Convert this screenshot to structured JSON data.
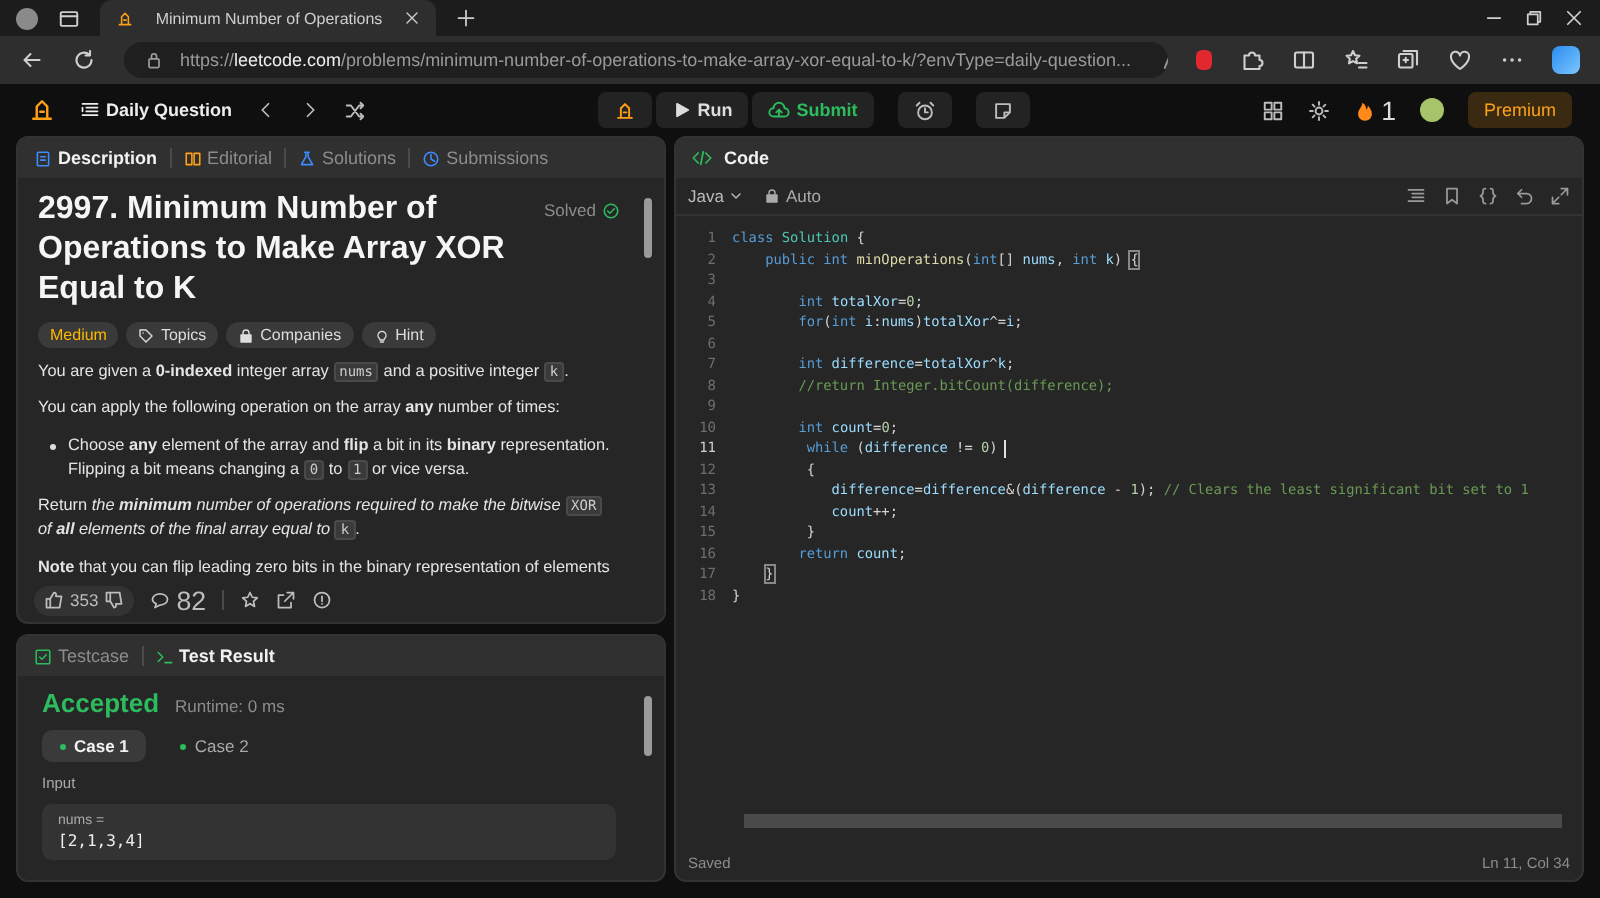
{
  "browser": {
    "tab_title": "Minimum Number of Operations",
    "url": {
      "scheme": "https://",
      "host": "leetcode.com",
      "path": "/problems/minimum-number-of-operations-to-make-array-xor-equal-to-k/?envType=daily-question..."
    }
  },
  "toolbar": {
    "daily_label": "Daily Question",
    "run": "Run",
    "submit": "Submit",
    "streak": "1",
    "premium": "Premium"
  },
  "description_panel": {
    "tabs": [
      {
        "label": "Description",
        "selected": true
      },
      {
        "label": "Editorial",
        "selected": false
      },
      {
        "label": "Solutions",
        "selected": false
      },
      {
        "label": "Submissions",
        "selected": false
      }
    ],
    "title": "2997. Minimum Number of Operations to Make Array XOR Equal to K",
    "status": "Solved",
    "tags": [
      {
        "kind": "difficulty",
        "label": "Medium"
      },
      {
        "kind": "topics",
        "label": "Topics"
      },
      {
        "kind": "companies",
        "label": "Companies"
      },
      {
        "kind": "hint",
        "label": "Hint"
      }
    ],
    "paragraphs": [
      {
        "kind": "para",
        "segments": [
          {
            "kind": "text",
            "text": "You are given a **0-indexed** integer array "
          },
          {
            "kind": "code",
            "text": "nums"
          },
          {
            "kind": "text",
            "text": " and a positive integer "
          },
          {
            "kind": "code",
            "text": "k"
          },
          {
            "kind": "text",
            "text": "."
          }
        ]
      },
      {
        "kind": "para",
        "segments": [
          {
            "kind": "text",
            "text": "You can apply the following operation on the array **any** number of times:"
          }
        ]
      },
      {
        "kind": "bullet",
        "segments": [
          {
            "kind": "text",
            "text": "Choose **any** element of the array and **flip** a bit in its **binary** representation. Flipping a bit means changing a "
          },
          {
            "kind": "code",
            "text": "0"
          },
          {
            "kind": "text",
            "text": " to "
          },
          {
            "kind": "code",
            "text": "1"
          },
          {
            "kind": "text",
            "text": " or vice versa."
          }
        ]
      },
      {
        "kind": "para",
        "segments": [
          {
            "kind": "text",
            "text": "Return "
          },
          {
            "kind": "italic",
            "text": "the **minimum** number of operations required to make the bitwise "
          },
          {
            "kind": "code",
            "text": "XOR"
          },
          {
            "kind": "italic",
            "text": " of **all** elements of the final array equal to "
          },
          {
            "kind": "code",
            "text": "k"
          },
          {
            "kind": "text",
            "text": "."
          }
        ]
      },
      {
        "kind": "para",
        "segments": [
          {
            "kind": "text",
            "text": "**Note** that you can flip leading zero bits in the binary representation of elements"
          }
        ]
      }
    ],
    "likes": "353",
    "comments": "82"
  },
  "test_panel": {
    "tabs": [
      {
        "label": "Testcase",
        "selected": false
      },
      {
        "label": "Test Result",
        "selected": true
      }
    ],
    "verdict": "Accepted",
    "runtime": "Runtime: 0 ms",
    "cases": [
      {
        "label": "Case 1",
        "selected": true,
        "passed": true
      },
      {
        "label": "Case 2",
        "selected": false,
        "passed": true
      }
    ],
    "input_label": "Input",
    "var_name": "nums =",
    "var_value": "[2,1,3,4]"
  },
  "editor": {
    "title": "Code",
    "language": "Java",
    "mode": "Auto",
    "lines": [
      {
        "number": "1",
        "current": false,
        "tokens": [
          {
            "kind": "kw",
            "t": "class "
          },
          {
            "kind": "type",
            "t": "Solution"
          },
          {
            "kind": "plain",
            "t": " {"
          }
        ]
      },
      {
        "number": "2",
        "current": false,
        "tokens": [
          {
            "kind": "kw",
            "t": "    public int "
          },
          {
            "kind": "fn",
            "t": "minOperations"
          },
          {
            "kind": "plain",
            "t": "("
          },
          {
            "kind": "kw",
            "t": "int"
          },
          {
            "kind": "plain",
            "t": "[] "
          },
          {
            "kind": "var",
            "t": "nums"
          },
          {
            "kind": "plain",
            "t": ", "
          },
          {
            "kind": "kw",
            "t": "int "
          },
          {
            "kind": "var",
            "t": "k"
          },
          {
            "kind": "plain",
            "t": ") "
          },
          {
            "kind": "bracket",
            "t": "{"
          }
        ]
      },
      {
        "number": "3",
        "current": false
      },
      {
        "number": "4",
        "current": false,
        "tokens": [
          {
            "kind": "kw",
            "t": "        int "
          },
          {
            "kind": "var",
            "t": "totalXor"
          },
          {
            "kind": "plain",
            "t": "="
          },
          {
            "kind": "num",
            "t": "0"
          },
          {
            "kind": "plain",
            "t": ";"
          }
        ]
      },
      {
        "number": "5",
        "current": false,
        "tokens": [
          {
            "kind": "kw",
            "t": "        for"
          },
          {
            "kind": "plain",
            "t": "("
          },
          {
            "kind": "kw",
            "t": "int "
          },
          {
            "kind": "var",
            "t": "i"
          },
          {
            "kind": "plain",
            "t": ":"
          },
          {
            "kind": "var",
            "t": "nums"
          },
          {
            "kind": "plain",
            "t": ")"
          },
          {
            "kind": "var",
            "t": "totalXor"
          },
          {
            "kind": "plain",
            "t": "^="
          },
          {
            "kind": "var",
            "t": "i"
          },
          {
            "kind": "plain",
            "t": ";"
          }
        ]
      },
      {
        "number": "6",
        "current": false
      },
      {
        "number": "7",
        "current": false,
        "tokens": [
          {
            "kind": "kw",
            "t": "        int "
          },
          {
            "kind": "var",
            "t": "difference"
          },
          {
            "kind": "plain",
            "t": "="
          },
          {
            "kind": "var",
            "t": "totalXor"
          },
          {
            "kind": "plain",
            "t": "^"
          },
          {
            "kind": "var",
            "t": "k"
          },
          {
            "kind": "plain",
            "t": ";"
          }
        ]
      },
      {
        "number": "8",
        "current": false,
        "tokens": [
          {
            "kind": "comment",
            "t": "        //return Integer.bitCount(difference);"
          }
        ]
      },
      {
        "number": "9",
        "current": false
      },
      {
        "number": "10",
        "current": false,
        "tokens": [
          {
            "kind": "kw",
            "t": "        int "
          },
          {
            "kind": "var",
            "t": "count"
          },
          {
            "kind": "plain",
            "t": "="
          },
          {
            "kind": "num",
            "t": "0"
          },
          {
            "kind": "plain",
            "t": ";"
          }
        ]
      },
      {
        "number": "11",
        "current": true,
        "tokens": [
          {
            "kind": "kw",
            "t": "         while"
          },
          {
            "kind": "plain",
            "t": " ("
          },
          {
            "kind": "var",
            "t": "difference"
          },
          {
            "kind": "plain",
            "t": " != "
          },
          {
            "kind": "num",
            "t": "0"
          },
          {
            "kind": "plain",
            "t": ")"
          }
        ]
      },
      {
        "number": "12",
        "current": false,
        "tokens": [
          {
            "kind": "plain",
            "t": "         {"
          }
        ]
      },
      {
        "number": "13",
        "current": false,
        "tokens": [
          {
            "kind": "var",
            "t": "            difference"
          },
          {
            "kind": "plain",
            "t": "="
          },
          {
            "kind": "var",
            "t": "difference"
          },
          {
            "kind": "plain",
            "t": "&("
          },
          {
            "kind": "var",
            "t": "difference"
          },
          {
            "kind": "plain",
            "t": " - "
          },
          {
            "kind": "num",
            "t": "1"
          },
          {
            "kind": "plain",
            "t": "); "
          },
          {
            "kind": "comment",
            "t": "// Clears the least significant bit set to 1"
          }
        ]
      },
      {
        "number": "14",
        "current": false,
        "tokens": [
          {
            "kind": "var",
            "t": "            count"
          },
          {
            "kind": "plain",
            "t": "++;"
          }
        ]
      },
      {
        "number": "15",
        "current": false,
        "tokens": [
          {
            "kind": "plain",
            "t": "         }"
          }
        ]
      },
      {
        "number": "16",
        "current": false,
        "tokens": [
          {
            "kind": "kw",
            "t": "        return "
          },
          {
            "kind": "var",
            "t": "count"
          },
          {
            "kind": "plain",
            "t": ";"
          }
        ]
      },
      {
        "number": "17",
        "current": false,
        "tokens": [
          {
            "kind": "bracket",
            "t": "    }"
          }
        ]
      },
      {
        "number": "18",
        "current": false,
        "tokens": [
          {
            "kind": "plain",
            "t": "}"
          }
        ]
      }
    ],
    "status": "Saved",
    "position": "Ln 11, Col 34"
  }
}
